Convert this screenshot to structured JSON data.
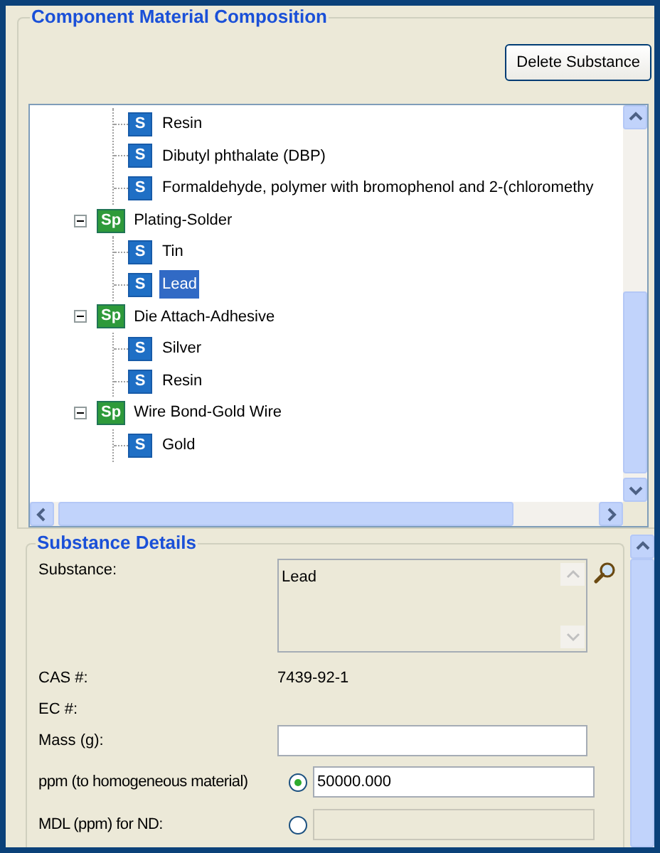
{
  "composition": {
    "title": "Component Material Composition",
    "delete_button": "Delete Substance",
    "tree": [
      {
        "kind": "group",
        "children": [
          {
            "kind": "substance",
            "badge": "S",
            "label": "Resin",
            "selected": false
          },
          {
            "kind": "substance",
            "badge": "S",
            "label": "Dibutyl phthalate (DBP)",
            "selected": false
          },
          {
            "kind": "substance",
            "badge": "S",
            "label": "Formaldehyde, polymer with bromophenol and 2-(chloromethy",
            "selected": false
          }
        ]
      },
      {
        "kind": "group",
        "expanded": true,
        "badge": "Sp",
        "label": "Plating-Solder",
        "children": [
          {
            "kind": "substance",
            "badge": "S",
            "label": "Tin",
            "selected": false
          },
          {
            "kind": "substance",
            "badge": "S",
            "label": "Lead",
            "selected": true
          }
        ]
      },
      {
        "kind": "group",
        "expanded": true,
        "badge": "Sp",
        "label": "Die Attach-Adhesive",
        "children": [
          {
            "kind": "substance",
            "badge": "S",
            "label": "Silver",
            "selected": false
          },
          {
            "kind": "substance",
            "badge": "S",
            "label": "Resin",
            "selected": false
          }
        ]
      },
      {
        "kind": "group",
        "expanded": true,
        "badge": "Sp",
        "label": "Wire Bond-Gold Wire",
        "children": [
          {
            "kind": "substance",
            "badge": "S",
            "label": "Gold",
            "selected": false
          }
        ]
      }
    ]
  },
  "details": {
    "title": "Substance Details",
    "substance": {
      "label": "Substance:",
      "value": "Lead"
    },
    "cas": {
      "label": "CAS #:",
      "value": "7439-92-1"
    },
    "ec": {
      "label": "EC #:"
    },
    "mass": {
      "label": "Mass (g):"
    },
    "options": [
      {
        "label": "ppm (to homogeneous material)",
        "selected": true,
        "value": "50000.000"
      },
      {
        "label": "MDL (ppm) for ND:",
        "selected": false
      }
    ]
  }
}
